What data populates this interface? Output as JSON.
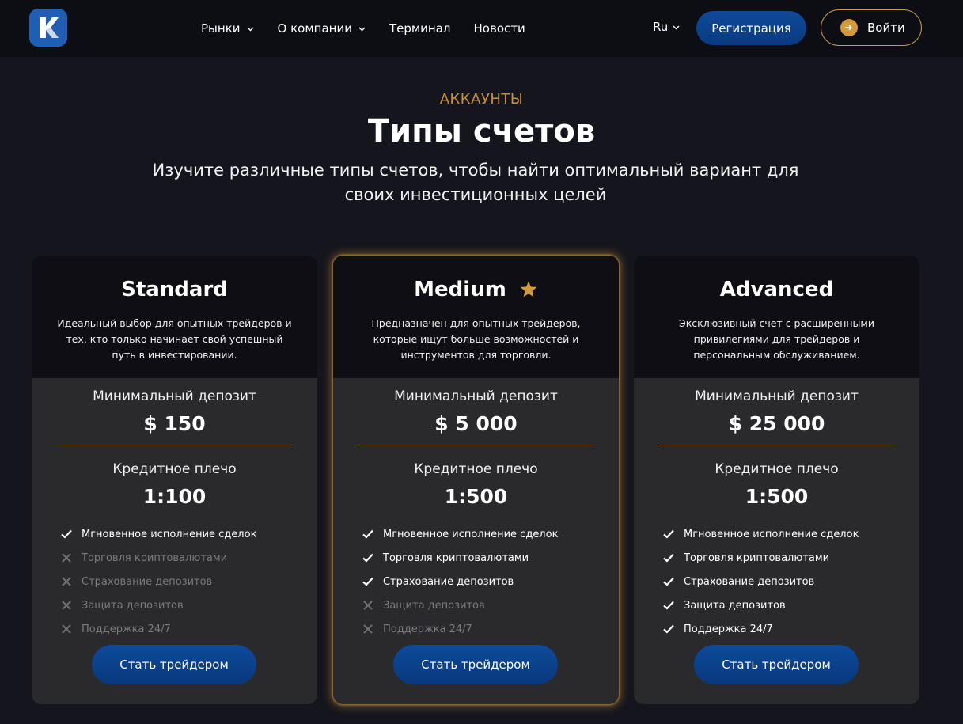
{
  "header": {
    "nav": [
      {
        "label": "Рынки",
        "has_dropdown": true
      },
      {
        "label": "О компании",
        "has_dropdown": true
      },
      {
        "label": "Терминал",
        "has_dropdown": false
      },
      {
        "label": "Новости",
        "has_dropdown": false
      }
    ],
    "language": "Ru",
    "register_label": "Регистрация",
    "login_label": "Войти"
  },
  "hero": {
    "eyebrow": "АККАУНТЫ",
    "title": "Типы счетов",
    "subtitle_line1": "Изучите различные типы счетов, чтобы найти оптимальный вариант для",
    "subtitle_line2": "своих инвестиционных целей"
  },
  "colors": {
    "accent_gold": "#c8913a",
    "primary_blue": "#0e4a9a",
    "background": "#14151d"
  },
  "plans": [
    {
      "name": "Standard",
      "featured": false,
      "description": "Идеальный выбор для опытных трейдеров и тех, кто только начинает свой успешный путь в инвестировании.",
      "deposit_label": "Минимальный депозит",
      "deposit_value": "$ 150",
      "leverage_label": "Кредитное плечо",
      "leverage_value": "1:100",
      "features": [
        {
          "label": "Мгновенное исполнение сделок",
          "included": true
        },
        {
          "label": "Торговля криптовалютами",
          "included": false
        },
        {
          "label": "Страхование депозитов",
          "included": false
        },
        {
          "label": "Защита депозитов",
          "included": false
        },
        {
          "label": "Поддержка 24/7",
          "included": false
        }
      ],
      "cta_label": "Стать трейдером"
    },
    {
      "name": "Medium",
      "featured": true,
      "description": "Предназначен для опытных трейдеров, которые ищут больше возможностей и инструментов для торговли.",
      "deposit_label": "Минимальный депозит",
      "deposit_value": "$ 5 000",
      "leverage_label": "Кредитное плечо",
      "leverage_value": "1:500",
      "features": [
        {
          "label": "Мгновенное исполнение сделок",
          "included": true
        },
        {
          "label": "Торговля криптовалютами",
          "included": true
        },
        {
          "label": "Страхование депозитов",
          "included": true
        },
        {
          "label": "Защита депозитов",
          "included": false
        },
        {
          "label": "Поддержка 24/7",
          "included": false
        }
      ],
      "cta_label": "Стать трейдером"
    },
    {
      "name": "Advanced",
      "featured": false,
      "description": "Эксклюзивный счет с расширенными привилегиями для трейдеров и персональным обслуживанием.",
      "deposit_label": "Минимальный депозит",
      "deposit_value": "$ 25 000",
      "leverage_label": "Кредитное плечо",
      "leverage_value": "1:500",
      "features": [
        {
          "label": "Мгновенное исполнение сделок",
          "included": true
        },
        {
          "label": "Торговля криптовалютами",
          "included": true
        },
        {
          "label": "Страхование депозитов",
          "included": true
        },
        {
          "label": "Защита депозитов",
          "included": true
        },
        {
          "label": "Поддержка 24/7",
          "included": true
        }
      ],
      "cta_label": "Стать трейдером"
    }
  ]
}
